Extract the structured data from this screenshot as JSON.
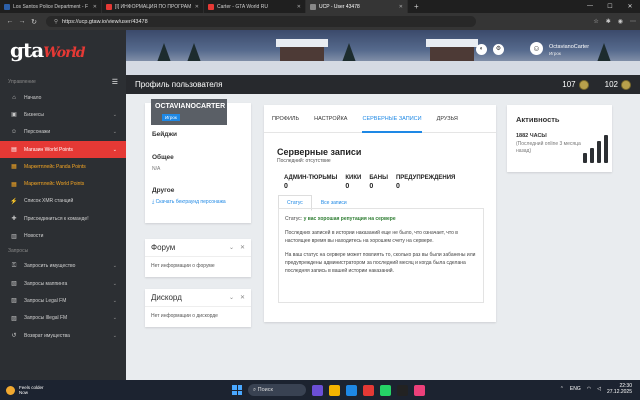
{
  "browser": {
    "tabs": [
      {
        "label": "Los Santos Police Department - F",
        "color": "#2c5fa8"
      },
      {
        "label": "[I] ИНФОРМАЦИЯ ПО ПРОГРАМ",
        "color": "#e53935"
      },
      {
        "label": "Carter - GTA World RU",
        "color": "#e53935"
      },
      {
        "label": "UCP - User 43478",
        "color": "#555555"
      }
    ],
    "url": "https://ucp.gtaw.io/view/user/43478"
  },
  "sidebar": {
    "section_label": "Управление",
    "items": [
      {
        "label": "Начало",
        "icon": "home-icon"
      },
      {
        "label": "Бизнесы",
        "icon": "briefcase-icon",
        "chevron": true
      },
      {
        "label": "Персонажи",
        "icon": "user-icon",
        "chevron": true
      },
      {
        "label": "Магазин World Points",
        "icon": "cart-icon",
        "chevron": true,
        "active": true
      },
      {
        "label": "Маркетплейс Panda Points",
        "icon": "store-icon",
        "highlight": true
      },
      {
        "label": "Маркетплейс World Points",
        "icon": "store-icon",
        "highlight": true
      },
      {
        "label": "Список XMR станций",
        "icon": "radio-icon"
      },
      {
        "label": "Присоединиться к команде!",
        "icon": "join-icon"
      },
      {
        "label": "Новости",
        "icon": "news-icon"
      }
    ],
    "section2_label": "Запросы",
    "items2": [
      {
        "label": "Запросить имущество",
        "icon": "key-icon",
        "chevron": true
      },
      {
        "label": "Запросы маппинга",
        "icon": "map-icon",
        "chevron": true
      },
      {
        "label": "Запросы Legal FM",
        "icon": "radio-icon",
        "chevron": true
      },
      {
        "label": "Запросы Illegal FM",
        "icon": "radio-icon",
        "chevron": true
      },
      {
        "label": "Возврат имущества",
        "icon": "refresh-icon",
        "chevron": true
      }
    ]
  },
  "header": {
    "user_name": "OctavianoCarter",
    "user_role": "Игрок",
    "page_title": "Профиль пользователя",
    "stat1": "107",
    "stat2": "102"
  },
  "profile": {
    "name": "OCTAVIANOCARTER",
    "role": "Игрок",
    "badges_label": "Бейджи",
    "general_label": "Общее",
    "general_value": "N/A",
    "other_label": "Другое",
    "download_link": "Скачать бекграунд персонажа"
  },
  "forum": {
    "title": "Форум",
    "body": "Нет информации о форуме"
  },
  "discord": {
    "title": "Дискорд",
    "body": "Нет информации о дискорде"
  },
  "main": {
    "tabs": [
      "ПРОФИЛЬ",
      "НАСТРОЙКА",
      "СЕРВЕРНЫЕ ЗАПИСИ",
      "ДРУЗЬЯ"
    ],
    "title": "Серверные записи",
    "last": "Последний: отсутствие",
    "counts": [
      {
        "label": "АДМИН-ТЮРЬМЫ",
        "value": "0"
      },
      {
        "label": "КИКИ",
        "value": "0"
      },
      {
        "label": "БАНЫ",
        "value": "0"
      },
      {
        "label": "ПРЕДУПРЕЖДЕНИЯ",
        "value": "0"
      }
    ],
    "subtabs": [
      "Статус",
      "Все записи"
    ],
    "status_prefix": "Статус:",
    "status_value": "у вас хорошая репутация на сервере",
    "para1": "Последних записей в истории наказаний еще не было, что означает, что в настоящее время вы находитесь на хорошем счету на сервере.",
    "para2": "На ваш статус на сервере может повлиять то, сколько раз вы были забанены или предупреждены администратором за последний месяц и когда была сделана последняя запись в вашей истории наказаний."
  },
  "activity": {
    "title": "Активность",
    "hours": "1882 ЧАСЫ",
    "sub": "(Последний online 3 месяца назад)",
    "bars": [
      0.35,
      0.55,
      0.8,
      1.0
    ]
  },
  "taskbar": {
    "weather_title": "Feels colder",
    "weather_sub": "Now",
    "search": "Поиск",
    "lang": "ENG",
    "time": "22:30",
    "date": "27.12.2025"
  },
  "colors": {
    "accent": "#e53935",
    "link": "#1e88e5",
    "sidebar": "#2c2f33",
    "good": "#2e7d32"
  }
}
